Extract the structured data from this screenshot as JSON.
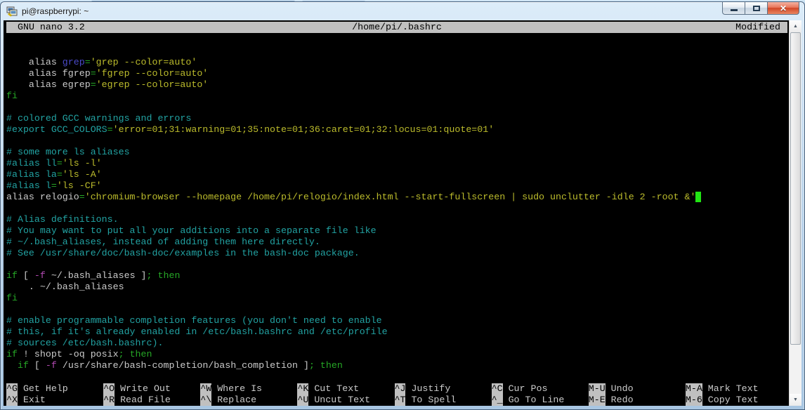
{
  "window": {
    "title": "pi@raspberrypi: ~"
  },
  "nano": {
    "version_label": "GNU nano 3.2",
    "file_path": "/home/pi/.bashrc",
    "status": "Modified"
  },
  "colors": {
    "fg": "#cbcbcb",
    "cyan": "#22a3a3",
    "green": "#26a826",
    "yellow": "#bcbc2c",
    "blue": "#4a4ac9",
    "magenta": "#b44ab4",
    "cursor": "#21e413",
    "bar_bg": "#c0c0c0",
    "bar_fg": "#000000"
  },
  "editor": {
    "lines": [
      [],
      [],
      [
        [
          "w",
          "    alias "
        ],
        [
          "b",
          "grep"
        ],
        [
          "g",
          "="
        ],
        [
          "y",
          "'grep --color=auto'"
        ]
      ],
      [
        [
          "w",
          "    alias fgrep"
        ],
        [
          "g",
          "="
        ],
        [
          "y",
          "'fgrep --color=auto'"
        ]
      ],
      [
        [
          "w",
          "    alias egrep"
        ],
        [
          "g",
          "="
        ],
        [
          "y",
          "'egrep --color=auto'"
        ]
      ],
      [
        [
          "g",
          "fi"
        ]
      ],
      [],
      [
        [
          "c",
          "# colored GCC warnings and errors"
        ]
      ],
      [
        [
          "c",
          "#export GCC_COLORS"
        ],
        [
          "g",
          "="
        ],
        [
          "y",
          "'error=01;31:warning=01;35:note=01;36:caret=01;32:locus=01:quote=01'"
        ]
      ],
      [],
      [
        [
          "c",
          "# some more ls aliases"
        ]
      ],
      [
        [
          "c",
          "#alias ll"
        ],
        [
          "g",
          "="
        ],
        [
          "y",
          "'ls -l'"
        ]
      ],
      [
        [
          "c",
          "#alias la"
        ],
        [
          "g",
          "="
        ],
        [
          "y",
          "'ls -A'"
        ]
      ],
      [
        [
          "c",
          "#alias l"
        ],
        [
          "g",
          "="
        ],
        [
          "y",
          "'ls -CF'"
        ]
      ],
      [
        [
          "w",
          "alias relogio"
        ],
        [
          "g",
          "="
        ],
        [
          "y",
          "'chromium-browser --homepage /home/pi/relogio/index.html --start-fullscreen | sudo unclutter -idle 2 -root &'"
        ],
        [
          "cur",
          " "
        ]
      ],
      [],
      [
        [
          "c",
          "# Alias definitions."
        ]
      ],
      [
        [
          "c",
          "# You may want to put all your additions into a separate file like"
        ]
      ],
      [
        [
          "c",
          "# ~/.bash_aliases, instead of adding them here directly."
        ]
      ],
      [
        [
          "c",
          "# See /usr/share/doc/bash-doc/examples in the bash-doc package."
        ]
      ],
      [],
      [
        [
          "g",
          "if"
        ],
        [
          "w",
          " [ "
        ],
        [
          "m",
          "-f"
        ],
        [
          "w",
          " ~/.bash_aliases ]"
        ],
        [
          "g",
          ";"
        ],
        [
          "w",
          " "
        ],
        [
          "g",
          "then"
        ]
      ],
      [
        [
          "w",
          "    . ~/.bash_aliases"
        ]
      ],
      [
        [
          "g",
          "fi"
        ]
      ],
      [],
      [
        [
          "c",
          "# enable programmable completion features (you don't need to enable"
        ]
      ],
      [
        [
          "c",
          "# this, if it's already enabled in /etc/bash.bashrc and /etc/profile"
        ]
      ],
      [
        [
          "c",
          "# sources /etc/bash.bashrc)."
        ]
      ],
      [
        [
          "g",
          "if"
        ],
        [
          "w",
          " ! shopt -oq posix"
        ],
        [
          "g",
          ";"
        ],
        [
          "w",
          " "
        ],
        [
          "g",
          "then"
        ]
      ],
      [
        [
          "w",
          "  "
        ],
        [
          "g",
          "if"
        ],
        [
          "w",
          " [ "
        ],
        [
          "m",
          "-f"
        ],
        [
          "w",
          " /usr/share/bash-completion/bash_completion ]"
        ],
        [
          "g",
          ";"
        ],
        [
          "w",
          " "
        ],
        [
          "g",
          "then"
        ]
      ]
    ]
  },
  "shortcut_rows": [
    [
      {
        "key": "^G",
        "label": "Get Help"
      },
      {
        "key": "^O",
        "label": "Write Out"
      },
      {
        "key": "^W",
        "label": "Where Is"
      },
      {
        "key": "^K",
        "label": "Cut Text"
      },
      {
        "key": "^J",
        "label": "Justify"
      },
      {
        "key": "^C",
        "label": "Cur Pos"
      },
      {
        "key": "M-U",
        "label": "Undo"
      },
      {
        "key": "M-A",
        "label": "Mark Text"
      }
    ],
    [
      {
        "key": "^X",
        "label": "Exit"
      },
      {
        "key": "^R",
        "label": "Read File"
      },
      {
        "key": "^\\",
        "label": "Replace"
      },
      {
        "key": "^U",
        "label": "Uncut Text"
      },
      {
        "key": "^T",
        "label": "To Spell"
      },
      {
        "key": "^_",
        "label": "Go To Line"
      },
      {
        "key": "M-E",
        "label": "Redo"
      },
      {
        "key": "M-6",
        "label": "Copy Text"
      }
    ]
  ]
}
